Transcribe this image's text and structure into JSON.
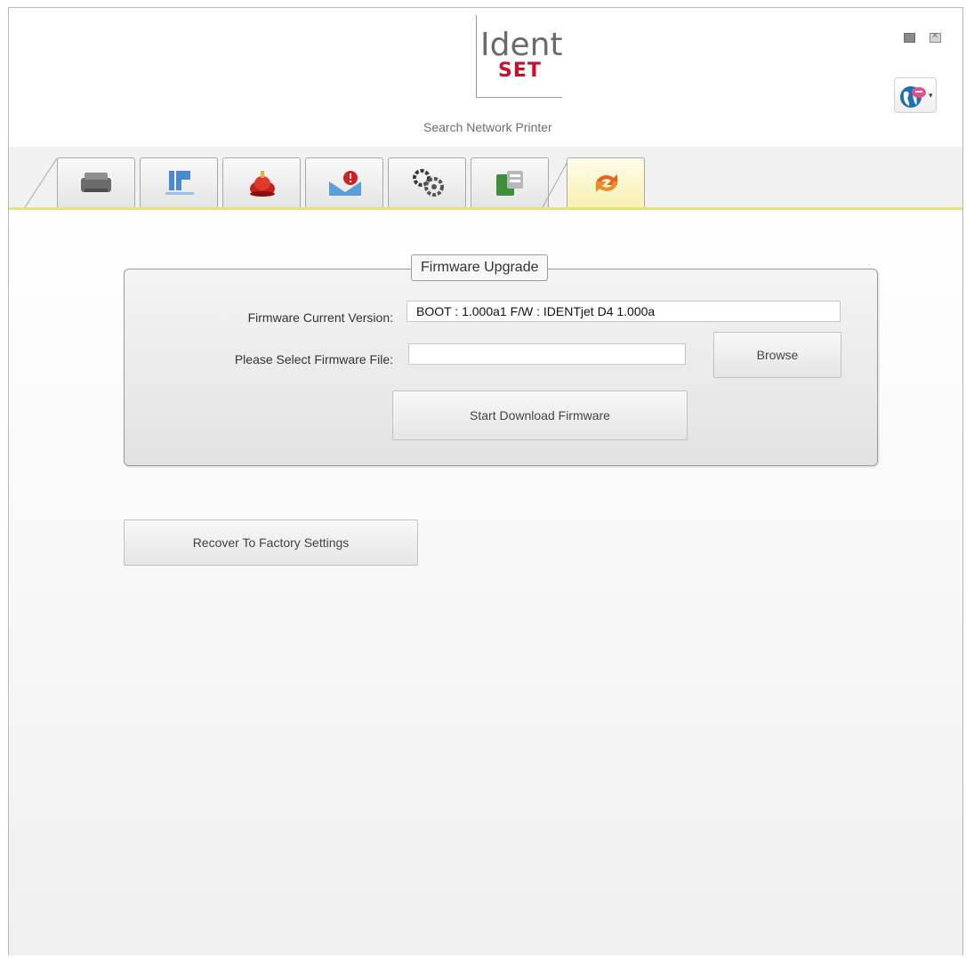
{
  "header": {
    "logo_ident": "Ident",
    "logo_set": "SET",
    "subtitle": "Search Network Printer"
  },
  "window_controls": [
    "minimize-icon",
    "close-icon"
  ],
  "language_button": {
    "icon": "globe-language-icon",
    "caret": "▾"
  },
  "tabs": [
    {
      "icon": "printer-icon",
      "active": false
    },
    {
      "icon": "ip-network-icon",
      "active": false
    },
    {
      "icon": "alarm-bell-icon",
      "active": false
    },
    {
      "icon": "email-alert-icon",
      "active": false
    },
    {
      "icon": "settings-gears-icon",
      "active": false
    },
    {
      "icon": "key-pad-icon",
      "active": false
    },
    {
      "icon": "refresh-arrows-icon",
      "active": true
    }
  ],
  "firmware": {
    "group_title": "Firmware Upgrade",
    "current_version_label": "Firmware Current Version:",
    "current_version_value": "BOOT : 1.000a1 F/W : IDENTjet D4 1.000a",
    "select_file_label": "Please Select Firmware File:",
    "select_file_value": "",
    "browse_label": "Browse",
    "download_label": "Start Download Firmware"
  },
  "factory": {
    "recover_label": "Recover To Factory  Settings"
  },
  "colors": {
    "accent_red": "#c8102e",
    "active_tab": "#f6f0b0",
    "tab_line": "#e8e27a"
  }
}
